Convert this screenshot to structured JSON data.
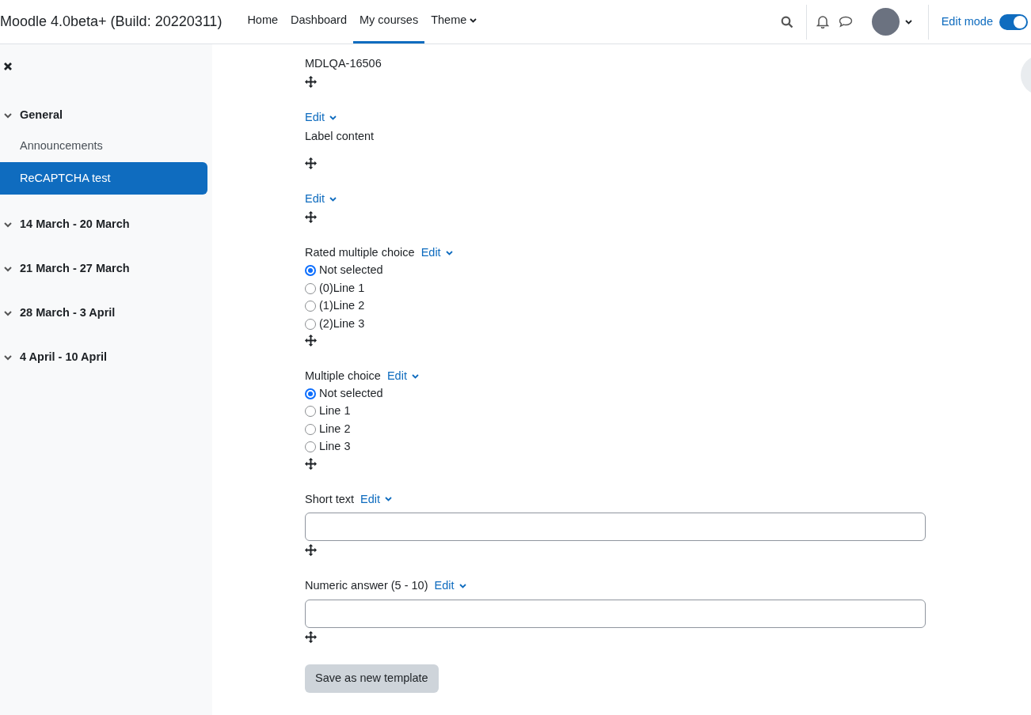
{
  "header": {
    "site_name": "Moodle 4.0beta+ (Build: 20220311)",
    "nav": [
      {
        "label": "Home",
        "selected": false,
        "dropdown": false
      },
      {
        "label": "Dashboard",
        "selected": false,
        "dropdown": false
      },
      {
        "label": "My courses",
        "selected": true,
        "dropdown": false
      },
      {
        "label": "Theme",
        "selected": false,
        "dropdown": true
      }
    ],
    "edit_mode": {
      "label": "Edit mode",
      "on": true
    }
  },
  "sidebar": {
    "items": [
      {
        "label": "General",
        "kind": "section",
        "selected": false,
        "expanded": true
      },
      {
        "label": "Announcements",
        "kind": "activity",
        "selected": false
      },
      {
        "label": "ReCAPTCHA test",
        "kind": "activity",
        "selected": true
      },
      {
        "label": "14 March - 20 March",
        "kind": "section",
        "selected": false,
        "expanded": true
      },
      {
        "label": "21 March - 27 March",
        "kind": "section",
        "selected": false,
        "expanded": true
      },
      {
        "label": "28 March - 3 April",
        "kind": "section",
        "selected": false,
        "expanded": true
      },
      {
        "label": "4 April - 10 April",
        "kind": "section",
        "selected": false,
        "expanded": true
      }
    ]
  },
  "fields": [
    {
      "kind": "text",
      "text": "MDLQA-16506"
    },
    {
      "kind": "label",
      "edit": "Edit",
      "text": "Label content"
    },
    {
      "kind": "label",
      "edit": "Edit"
    },
    {
      "kind": "radio",
      "title": "Rated multiple choice",
      "edit": "Edit",
      "options": [
        {
          "label": "Not selected",
          "selected": true
        },
        {
          "label": "(0)Line 1",
          "selected": false
        },
        {
          "label": "(1)Line 2",
          "selected": false
        },
        {
          "label": "(2)Line 3",
          "selected": false
        }
      ]
    },
    {
      "kind": "radio",
      "title": "Multiple choice",
      "edit": "Edit",
      "options": [
        {
          "label": "Not selected",
          "selected": true
        },
        {
          "label": "Line 1",
          "selected": false
        },
        {
          "label": "Line 2",
          "selected": false
        },
        {
          "label": "Line 3",
          "selected": false
        }
      ]
    },
    {
      "kind": "input",
      "title": "Short text",
      "edit": "Edit"
    },
    {
      "kind": "input",
      "title": "Numeric answer (5 - 10)",
      "edit": "Edit"
    }
  ],
  "save_button": "Save as new template"
}
